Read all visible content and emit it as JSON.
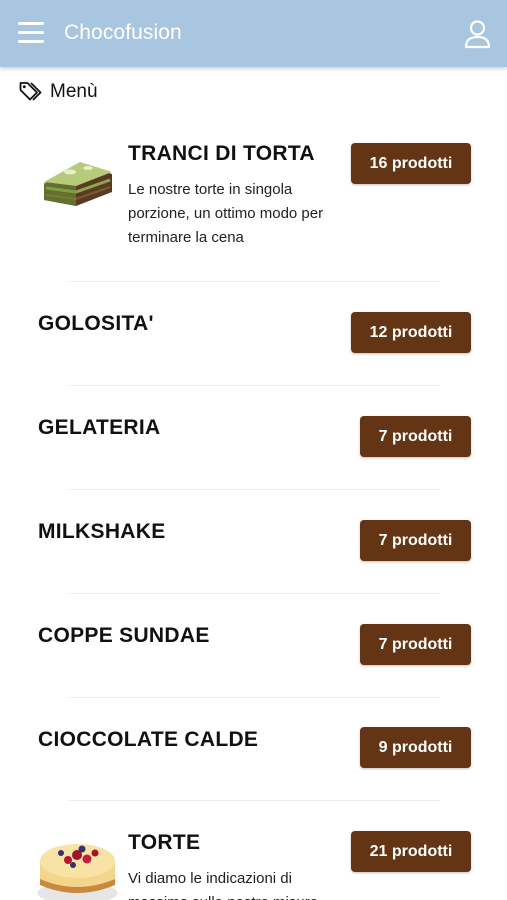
{
  "header": {
    "app_title": "Chocofusion",
    "menu_icon": "hamburger-menu-icon",
    "user_icon": "user-account-icon",
    "bar_color": "#a9c6e0"
  },
  "section": {
    "title": "Menù",
    "icon": "tag-icon"
  },
  "categories": [
    {
      "name": "TRANCI DI TORTA",
      "count_label": "16 prodotti",
      "description": "Le nostre torte in singola porzione, un ottimo modo per terminare la cena",
      "image": "pistachio-cake-slice"
    },
    {
      "name": "GOLOSITA'",
      "count_label": "12 prodotti"
    },
    {
      "name": "GELATERIA",
      "count_label": "7 prodotti"
    },
    {
      "name": "MILKSHAKE",
      "count_label": "7 prodotti"
    },
    {
      "name": "COPPE SUNDAE",
      "count_label": "7 prodotti"
    },
    {
      "name": "CIOCCOLATE CALDE",
      "count_label": "9 prodotti"
    },
    {
      "name": "TORTE",
      "count_label": "21 prodotti",
      "description": "Vi diamo le indicazioni di massima sulle nostre misure",
      "image": "berry-cheesecake"
    }
  ],
  "colors": {
    "badge": "#633514",
    "badge_text": "#ffffff"
  }
}
